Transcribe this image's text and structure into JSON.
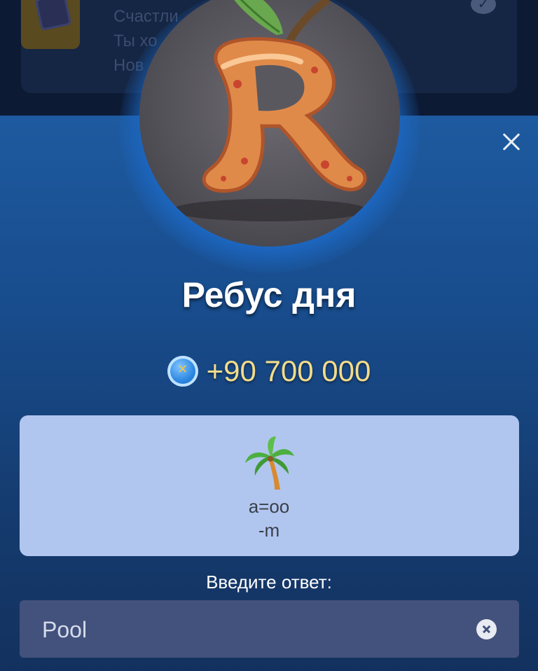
{
  "background_list": {
    "lines": [
      "Счастли",
      "Ты хо",
      "Нов"
    ]
  },
  "modal": {
    "title": "Ребус дня",
    "reward": {
      "amount": "+90 700 000",
      "coin_icon": "coin-icon"
    },
    "puzzle": {
      "image": "palm-tree-icon",
      "line1": "а=оо",
      "line2": "-m"
    },
    "answer": {
      "label": "Введите ответ:",
      "value": "Pool"
    }
  },
  "colors": {
    "sheet_top": "#1e5aa0",
    "sheet_bottom": "#13315e",
    "puzzle_bg": "#b1c6ef",
    "input_bg": "#43527c",
    "reward_text": "#f3dc8a"
  }
}
